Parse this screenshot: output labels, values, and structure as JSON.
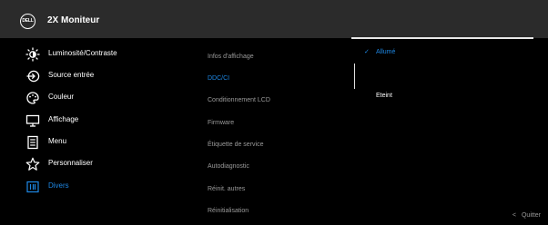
{
  "header": {
    "logo_text": "DELL",
    "title": "2X Moniteur"
  },
  "menu": {
    "items": [
      {
        "label": "Luminosité/Contraste",
        "icon": "brightness-icon"
      },
      {
        "label": "Source entrée",
        "icon": "input-source-icon"
      },
      {
        "label": "Couleur",
        "icon": "color-palette-icon"
      },
      {
        "label": "Affichage",
        "icon": "display-icon"
      },
      {
        "label": "Menu",
        "icon": "menu-icon"
      },
      {
        "label": "Personnaliser",
        "icon": "star-icon"
      },
      {
        "label": "Divers",
        "icon": "info-icon"
      }
    ],
    "active_index": 6
  },
  "submenu": {
    "items": [
      {
        "label": "Infos d'affichage"
      },
      {
        "label": "DDC/CI"
      },
      {
        "label": "Conditionnement LCD"
      },
      {
        "label": "Firmware"
      },
      {
        "label": "Étiquette de service"
      },
      {
        "label": "Autodiagnostic"
      },
      {
        "label": "Réinit. autres"
      },
      {
        "label": "Réinitialisation"
      }
    ],
    "active_index": 1
  },
  "options": {
    "items": [
      {
        "label": "Allumé",
        "selected": true
      },
      {
        "label": "Eteint",
        "selected": false
      }
    ],
    "check_glyph": "✓"
  },
  "footer": {
    "quit_chevron": "<",
    "quit_label": "Quitter"
  },
  "colors": {
    "accent": "#1e88e5",
    "header_bg": "#2b2b2b",
    "background": "#000000",
    "text": "#ffffff",
    "muted_text": "#9a9a9a"
  }
}
